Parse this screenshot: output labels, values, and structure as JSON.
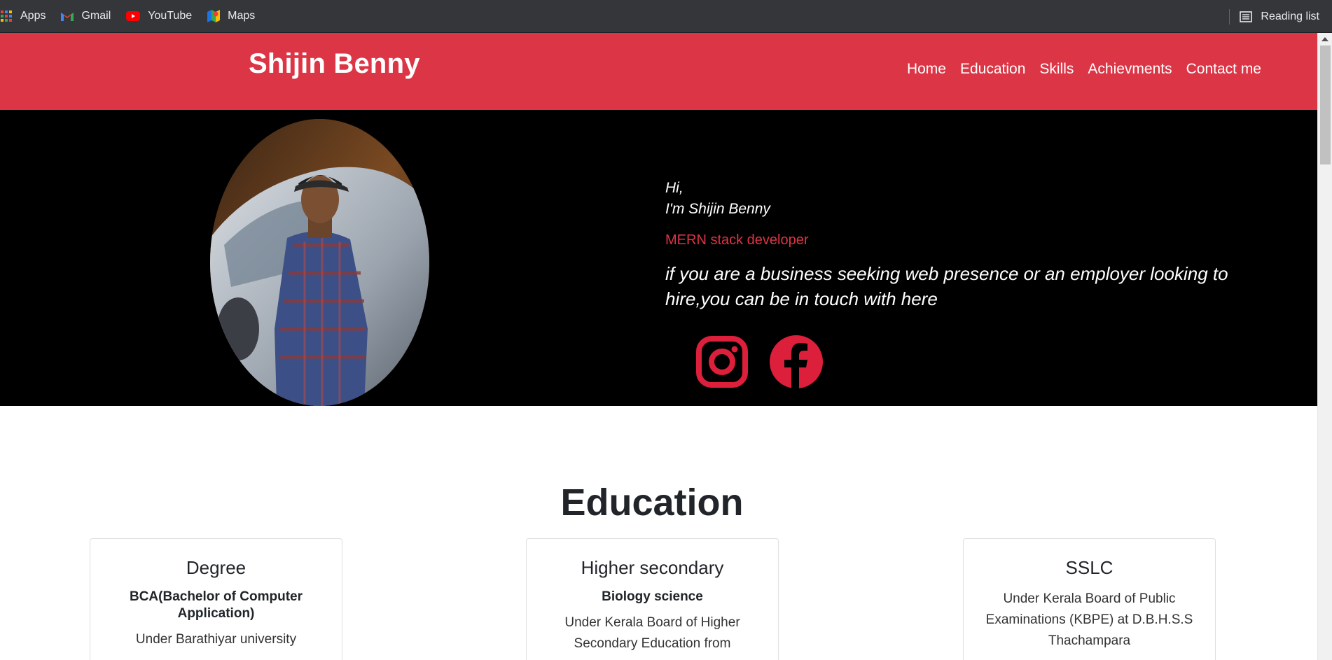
{
  "browser": {
    "bookmarks": [
      {
        "label": "Apps",
        "icon": "apps-grid-icon"
      },
      {
        "label": "Gmail",
        "icon": "gmail-icon"
      },
      {
        "label": "YouTube",
        "icon": "youtube-icon"
      },
      {
        "label": "Maps",
        "icon": "maps-icon"
      }
    ],
    "reading_list": "Reading list"
  },
  "nav": {
    "brand": "Shijin Benny",
    "links": [
      "Home",
      "Education",
      "Skills",
      "Achievments",
      "Contact me"
    ]
  },
  "hero": {
    "greeting": "Hi,",
    "intro": "I'm Shijin Benny",
    "role": "MERN stack developer",
    "pitch": "if you are a business seeking web presence or an employer looking to hire,you can be in touch with here",
    "socials": [
      "instagram-icon",
      "facebook-icon"
    ]
  },
  "education": {
    "title": "Education",
    "cards": [
      {
        "title": "Degree",
        "subtitle": "BCA(Bachelor of Computer Application)",
        "description": "Under Barathiyar university"
      },
      {
        "title": "Higher secondary",
        "subtitle": "Biology science",
        "description": "Under Kerala Board of Higher Secondary Education from"
      },
      {
        "title": "SSLC",
        "subtitle": "",
        "description": "Under Kerala Board of Public Examinations (KBPE) at D.B.H.S.S Thachampara"
      }
    ]
  },
  "colors": {
    "accent": "#dc3545",
    "hero_bg": "#000000",
    "bookmarks_bg": "#35363a"
  }
}
